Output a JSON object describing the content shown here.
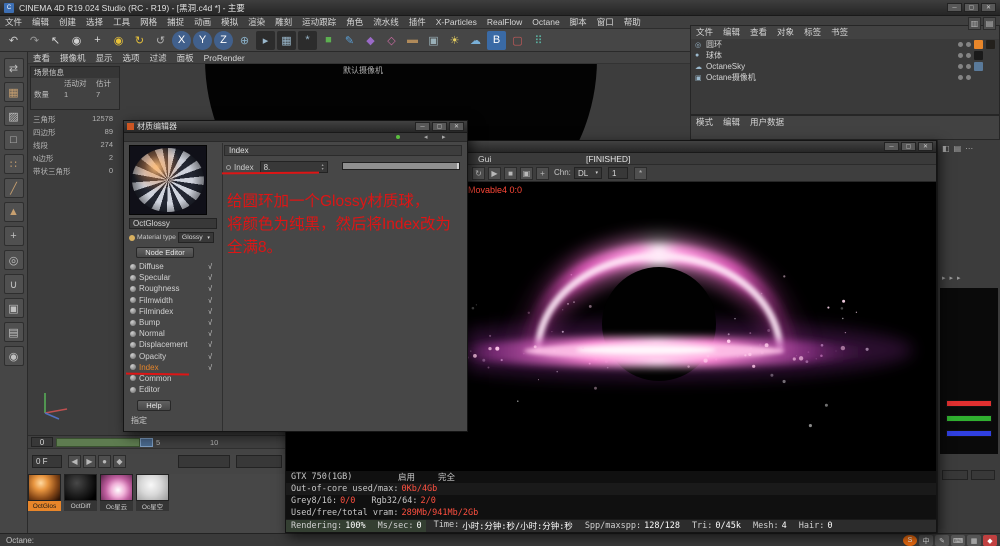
{
  "app": {
    "title": "CINEMA 4D R19.024 Studio (RC - R19) - [黑洞.c4d *] - 主要",
    "window_controls": {
      "min": "─",
      "max": "▢",
      "close": "✕"
    }
  },
  "glyphs": {
    "chevron_down": "▾",
    "spin_up": "▴",
    "spin_down": "▾",
    "nav_back": "◂",
    "nav_fwd": "▸",
    "layout_a": "▥",
    "layout_b": "▤"
  },
  "menubar": {
    "items": [
      "文件",
      "编辑",
      "创建",
      "选择",
      "工具",
      "网格",
      "捕捉",
      "动画",
      "模拟",
      "渲染",
      "雕刻",
      "运动跟踪",
      "角色",
      "流水线",
      "插件",
      "X-Particles",
      "RealFlow",
      "Octane",
      "脚本",
      "窗口",
      "帮助"
    ]
  },
  "toolbar": {
    "icons": [
      {
        "n": "undo-icon",
        "g": "↶",
        "c": "#cccccc",
        "bg": "transparent",
        "r": "2px"
      },
      {
        "n": "redo-icon",
        "g": "↷",
        "c": "#9a9a9a",
        "bg": "transparent",
        "r": "2px"
      },
      {
        "n": "select-tool-icon",
        "g": "↖",
        "c": "#d8d8d8",
        "bg": "transparent",
        "r": "2px"
      },
      {
        "n": "live-selection-icon",
        "g": "◉",
        "c": "#d0d0d0",
        "bg": "transparent",
        "r": "2px"
      },
      {
        "n": "move-tool-icon",
        "g": "+",
        "c": "#d8d8d8",
        "bg": "transparent",
        "r": "2px"
      },
      {
        "n": "scale-tool-icon",
        "g": "◉",
        "c": "#e8c23a",
        "bg": "transparent",
        "r": "2px"
      },
      {
        "n": "rotate-tool-icon",
        "g": "↻",
        "c": "#e8c23a",
        "bg": "transparent",
        "r": "2px"
      },
      {
        "n": "last-tool-icon",
        "g": "↺",
        "c": "#b0b0b0",
        "bg": "transparent",
        "r": "2px"
      },
      {
        "n": "x-axis-icon",
        "g": "X",
        "c": "#ffffff",
        "bg": "#41608c",
        "r": "50%"
      },
      {
        "n": "y-axis-icon",
        "g": "Y",
        "c": "#ffffff",
        "bg": "#41608c",
        "r": "50%"
      },
      {
        "n": "z-axis-icon",
        "g": "Z",
        "c": "#ffffff",
        "bg": "#41608c",
        "r": "50%"
      },
      {
        "n": "coord-system-icon",
        "g": "⊕",
        "c": "#8ab0c8",
        "bg": "transparent",
        "r": "2px"
      },
      {
        "n": "render-view-icon",
        "g": "▸",
        "c": "#9ab8cc",
        "bg": "#2c2c2c",
        "r": "2px"
      },
      {
        "n": "render-picture-viewer-icon",
        "g": "▦",
        "c": "#9ab8cc",
        "bg": "#2c2c2c",
        "r": "2px"
      },
      {
        "n": "render-settings-icon",
        "g": "*",
        "c": "#9ab8cc",
        "bg": "#2c2c2c",
        "r": "2px"
      },
      {
        "n": "add-cube-icon",
        "g": "■",
        "c": "#5cb050",
        "bg": "transparent",
        "r": "2px"
      },
      {
        "n": "spline-pen-icon",
        "g": "✎",
        "c": "#5aa0d8",
        "bg": "transparent",
        "r": "2px"
      },
      {
        "n": "generator-icon",
        "g": "◆",
        "c": "#9a6ac8",
        "bg": "transparent",
        "r": "2px"
      },
      {
        "n": "deformer-icon",
        "g": "◇",
        "c": "#c86aa0",
        "bg": "transparent",
        "r": "2px"
      },
      {
        "n": "floor-icon",
        "g": "▬",
        "c": "#b08a5a",
        "bg": "transparent",
        "r": "2px"
      },
      {
        "n": "camera-icon",
        "g": "▣",
        "c": "#9ab0b8",
        "bg": "transparent",
        "r": "2px"
      },
      {
        "n": "light-icon",
        "g": "☀",
        "c": "#e8d060",
        "bg": "transparent",
        "r": "2px"
      },
      {
        "n": "sky-icon",
        "g": "☁",
        "c": "#7ab0d8",
        "bg": "transparent",
        "r": "2px"
      },
      {
        "n": "bodypaint-icon",
        "g": "B",
        "c": "#ffffff",
        "bg": "#3a6aa5",
        "r": "2px"
      },
      {
        "n": "xpresso-icon",
        "g": "▢",
        "c": "#c85a5a",
        "bg": "transparent",
        "r": "2px"
      },
      {
        "n": "mograph-icon",
        "g": "⠿",
        "c": "#5ab0a0",
        "bg": "transparent",
        "r": "2px"
      }
    ]
  },
  "left_toolbar": {
    "icons": [
      {
        "n": "convert-icon",
        "g": "⇄",
        "c": "#c0c0c0"
      },
      {
        "n": "model-mode-icon",
        "g": "▦",
        "c": "#c8a070"
      },
      {
        "n": "texture-mode-icon",
        "g": "▨",
        "c": "#c0c0c0"
      },
      {
        "n": "workplane-icon",
        "g": "□",
        "c": "#c0c0c0"
      },
      {
        "n": "points-mode-icon",
        "g": "∷",
        "c": "#c8a070"
      },
      {
        "n": "edges-mode-icon",
        "g": "╱",
        "c": "#c8a070"
      },
      {
        "n": "polygons-mode-icon",
        "g": "▲",
        "c": "#c8a070"
      },
      {
        "n": "enable-axis-icon",
        "g": "+",
        "c": "#c0c0c0"
      },
      {
        "n": "viewport-solo-icon",
        "g": "◎",
        "c": "#c0c0c0"
      },
      {
        "n": "snap-icon",
        "g": "∪",
        "c": "#c0c0c0"
      },
      {
        "n": "lock-icon",
        "g": "▣",
        "c": "#c0c0c0"
      },
      {
        "n": "grid-icon",
        "g": "▤",
        "c": "#c0c0c0"
      },
      {
        "n": "layers-icon",
        "g": "◉",
        "c": "#c0c0c0"
      }
    ]
  },
  "viewport": {
    "menu": [
      "查看",
      "摄像机",
      "显示",
      "选项",
      "过滤",
      "面板",
      "ProRender"
    ],
    "camera_label": "默认摄像机",
    "scene_info": {
      "title": "场景信息",
      "col1": "活动对",
      "col2": "估计",
      "row_label": "数量",
      "v1": "1",
      "v2": "7"
    },
    "hud": [
      {
        "label": "三角形",
        "value": "12578"
      },
      {
        "label": "四边形",
        "value": "89"
      },
      {
        "label": "线段",
        "value": "274"
      },
      {
        "label": "N边形",
        "value": "2"
      },
      {
        "label": "带状三角形",
        "value": "0"
      }
    ]
  },
  "object_manager": {
    "menu": [
      "文件",
      "编辑",
      "查看",
      "对象",
      "标签",
      "书签"
    ],
    "objects": [
      {
        "icon": "◎",
        "name": "圆环",
        "t1": "#e8862a",
        "t2": "#23201c"
      },
      {
        "icon": "●",
        "name": "球体",
        "t1": "#1a1a1a",
        "t2": ""
      },
      {
        "icon": "☁",
        "name": "OctaneSky",
        "t1": "#5a7a9a",
        "t2": ""
      },
      {
        "icon": "▣",
        "name": "Octane摄像机",
        "t1": "",
        "t2": ""
      }
    ]
  },
  "attribute_manager": {
    "menu": [
      "模式",
      "编辑",
      "用户数据"
    ]
  },
  "right_column": {
    "top_icons": [
      "◧",
      "▤",
      "⋯"
    ],
    "mid_icons": [
      "▸",
      "▸",
      "▸"
    ],
    "strips": [
      "#e03030",
      "#30b030",
      "#3040e0"
    ]
  },
  "timeline": {
    "current": "0",
    "tick1": "5",
    "tick2": "10",
    "frame_field": "0 F"
  },
  "transport_bar": {
    "buttons": [
      "◀",
      "▶",
      "●",
      "◆"
    ]
  },
  "materials_palette": {
    "items": [
      {
        "label": "OctGlos",
        "lbg": "#e8862a",
        "lc": "#181818",
        "thumb": "radial-gradient(circle at 38% 32%, #ffd9a0 0%, #e8953f 28%, #8a4a18 62%, #2a1205 95%)"
      },
      {
        "label": "OctDiff",
        "lbg": "#353535",
        "lc": "#cccccc",
        "thumb": "radial-gradient(circle at 38% 32%, #484848 0%, #1c1c1c 50%, #000000 85%)"
      },
      {
        "label": "Oc星云",
        "lbg": "#353535",
        "lc": "#cccccc",
        "thumb": "radial-gradient(circle at 55% 60%, #ffffff 0%, #f0b0d8 30%, #c060a0 55%, #5a2048 100%)"
      },
      {
        "label": "Oc星空",
        "lbg": "#353535",
        "lc": "#cccccc",
        "thumb": "radial-gradient(circle at 45% 40%, #f8f8f8 0%, #d8d8d8 45%, #9a9a9a 100%)"
      }
    ]
  },
  "material_editor": {
    "title": "材质编辑器",
    "material_name": "OctGlossy",
    "type_label": "Material type",
    "type_value": "Glossy",
    "node_editor": "Node Editor",
    "channels": [
      {
        "label": "Diffuse",
        "check": "√",
        "color": "#d2d2d2"
      },
      {
        "label": "Specular",
        "check": "√",
        "color": "#d2d2d2"
      },
      {
        "label": "Roughness",
        "check": "√",
        "color": "#d2d2d2"
      },
      {
        "label": "Filmwidth",
        "check": "√",
        "color": "#d2d2d2"
      },
      {
        "label": "Filmindex",
        "check": "√",
        "color": "#d2d2d2"
      },
      {
        "label": "Bump",
        "check": "√",
        "color": "#d2d2d2"
      },
      {
        "label": "Normal",
        "check": "√",
        "color": "#d2d2d2"
      },
      {
        "label": "Displacement",
        "check": "√",
        "color": "#d2d2d2"
      },
      {
        "label": "Opacity",
        "check": "√",
        "color": "#d2d2d2"
      },
      {
        "label": "Index",
        "check": "√",
        "color": "#e8862a"
      },
      {
        "label": "Common",
        "check": "",
        "color": "#d2d2d2"
      },
      {
        "label": "Editor",
        "check": "",
        "color": "#d2d2d2"
      }
    ],
    "help": "Help",
    "assign": "指定",
    "index_panel": {
      "header": "Index",
      "param": "Index",
      "value": "8."
    }
  },
  "octane": {
    "menu_gui": "Gui",
    "status": "[FINISHED]",
    "toolbar": {
      "icons": [
        {
          "n": "refresh-render-icon",
          "g": "↻"
        },
        {
          "n": "play-render-icon",
          "g": "▶"
        },
        {
          "n": "stop-render-icon",
          "g": "■"
        },
        {
          "n": "region-render-icon",
          "g": "▣"
        },
        {
          "n": "picking-icon",
          "g": "+"
        }
      ],
      "channel_label": "Chn:",
      "channel_value": "DL",
      "samples_value": "1"
    },
    "picking_info": "Movable4 0:0",
    "stats": {
      "gpu": "GTX 750(1GB)",
      "col_enable": "启用",
      "col_full": "完全",
      "rows": [
        {
          "label": "Out-of-core used/max:",
          "value": "0Kb/4Gb"
        },
        {
          "label": "Grey8/16:",
          "value": "0/0",
          "label2": "Rgb32/64:",
          "value2": "2/0"
        },
        {
          "label": "Used/free/total vram:",
          "value": "289Mb/941Mb/2Gb"
        }
      ]
    },
    "progress": [
      {
        "label": "Rendering:",
        "value": "100%"
      },
      {
        "label": "Ms/sec:",
        "value": "0"
      },
      {
        "label": "Time:",
        "value": "小时:分钟:秒/小时:分钟:秒"
      },
      {
        "label": "Spp/maxspp:",
        "value": "128/128"
      },
      {
        "label": "Tri:",
        "value": "0/45k"
      },
      {
        "label": "Mesh:",
        "value": "4"
      },
      {
        "label": "Hair:",
        "value": "0"
      }
    ]
  },
  "annotation": {
    "color": "#dd1515",
    "lines": [
      "给圆环加一个Glossy材质球，",
      "将颜色为纯黑，然后将Index改为",
      "全满8。"
    ]
  },
  "status_bar": {
    "left": "Octane:"
  },
  "input_bar": {
    "icons": [
      {
        "n": "sogou-logo-icon",
        "g": "S",
        "c": "#ffffff",
        "bg": "#e86a10",
        "r": "50%"
      },
      {
        "n": "input-mode-icon",
        "g": "中",
        "c": "#e8e8e8",
        "bg": "#555555",
        "r": "2px"
      },
      {
        "n": "pen-icon",
        "g": "✎",
        "c": "#cccccc",
        "bg": "#555555",
        "r": "2px"
      },
      {
        "n": "keyboard-icon",
        "g": "⌨",
        "c": "#cccccc",
        "bg": "#555555",
        "r": "2px"
      },
      {
        "n": "grid-icon",
        "g": "▦",
        "c": "#cccccc",
        "bg": "#555555",
        "r": "2px"
      },
      {
        "n": "badge-icon",
        "g": "◆",
        "c": "#ffffff",
        "bg": "#c04040",
        "r": "2px"
      }
    ]
  }
}
